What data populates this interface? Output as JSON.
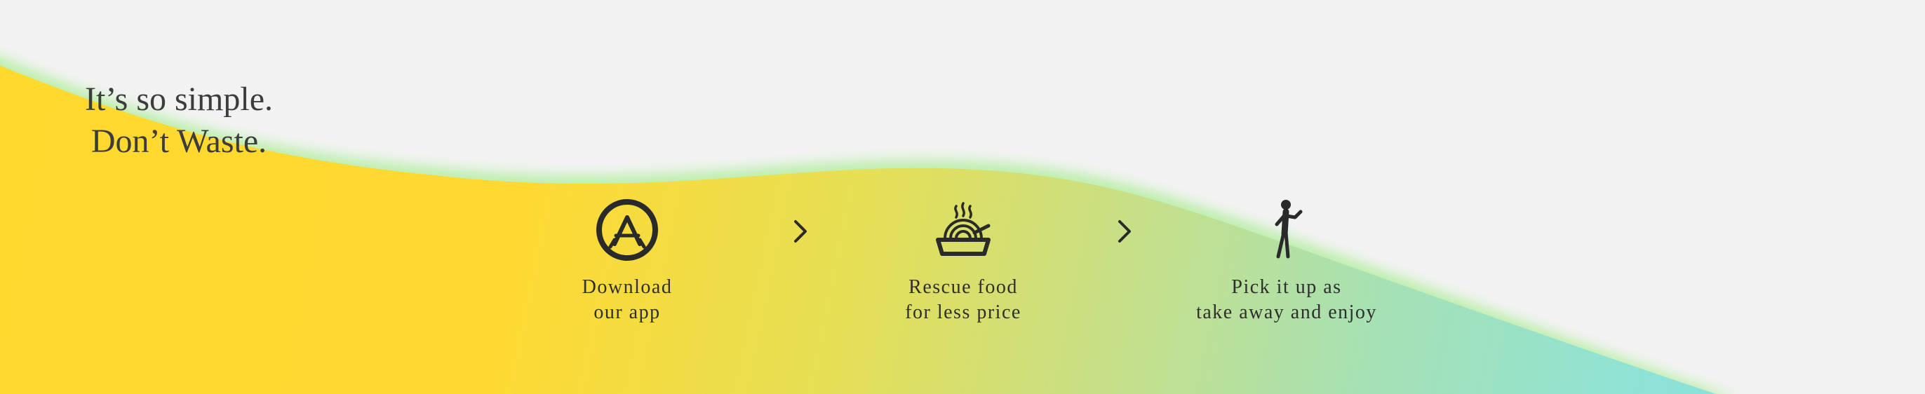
{
  "headline": {
    "line1": "It’s so simple.",
    "line2": "Don’t Waste."
  },
  "steps": [
    {
      "icon": "app-store-icon",
      "line1": "Download",
      "line2": "our app"
    },
    {
      "icon": "food-bowl-icon",
      "line1": "Rescue food",
      "line2": "for less price"
    },
    {
      "icon": "walking-person-icon",
      "line1": "Pick it up as",
      "line2": "take away and enjoy"
    }
  ],
  "separators": [
    "chevron-right-icon",
    "chevron-right-icon"
  ],
  "colors": {
    "background": "#f2f2f2",
    "gradient_start": "#ffd92e",
    "gradient_mid": "#dfe05a",
    "gradient_green": "#a8e2b0",
    "gradient_end": "#88e2e2",
    "edge_glow": "#b6f0b0",
    "text": "#3c3c3c",
    "icon": "#2a2a2a"
  }
}
